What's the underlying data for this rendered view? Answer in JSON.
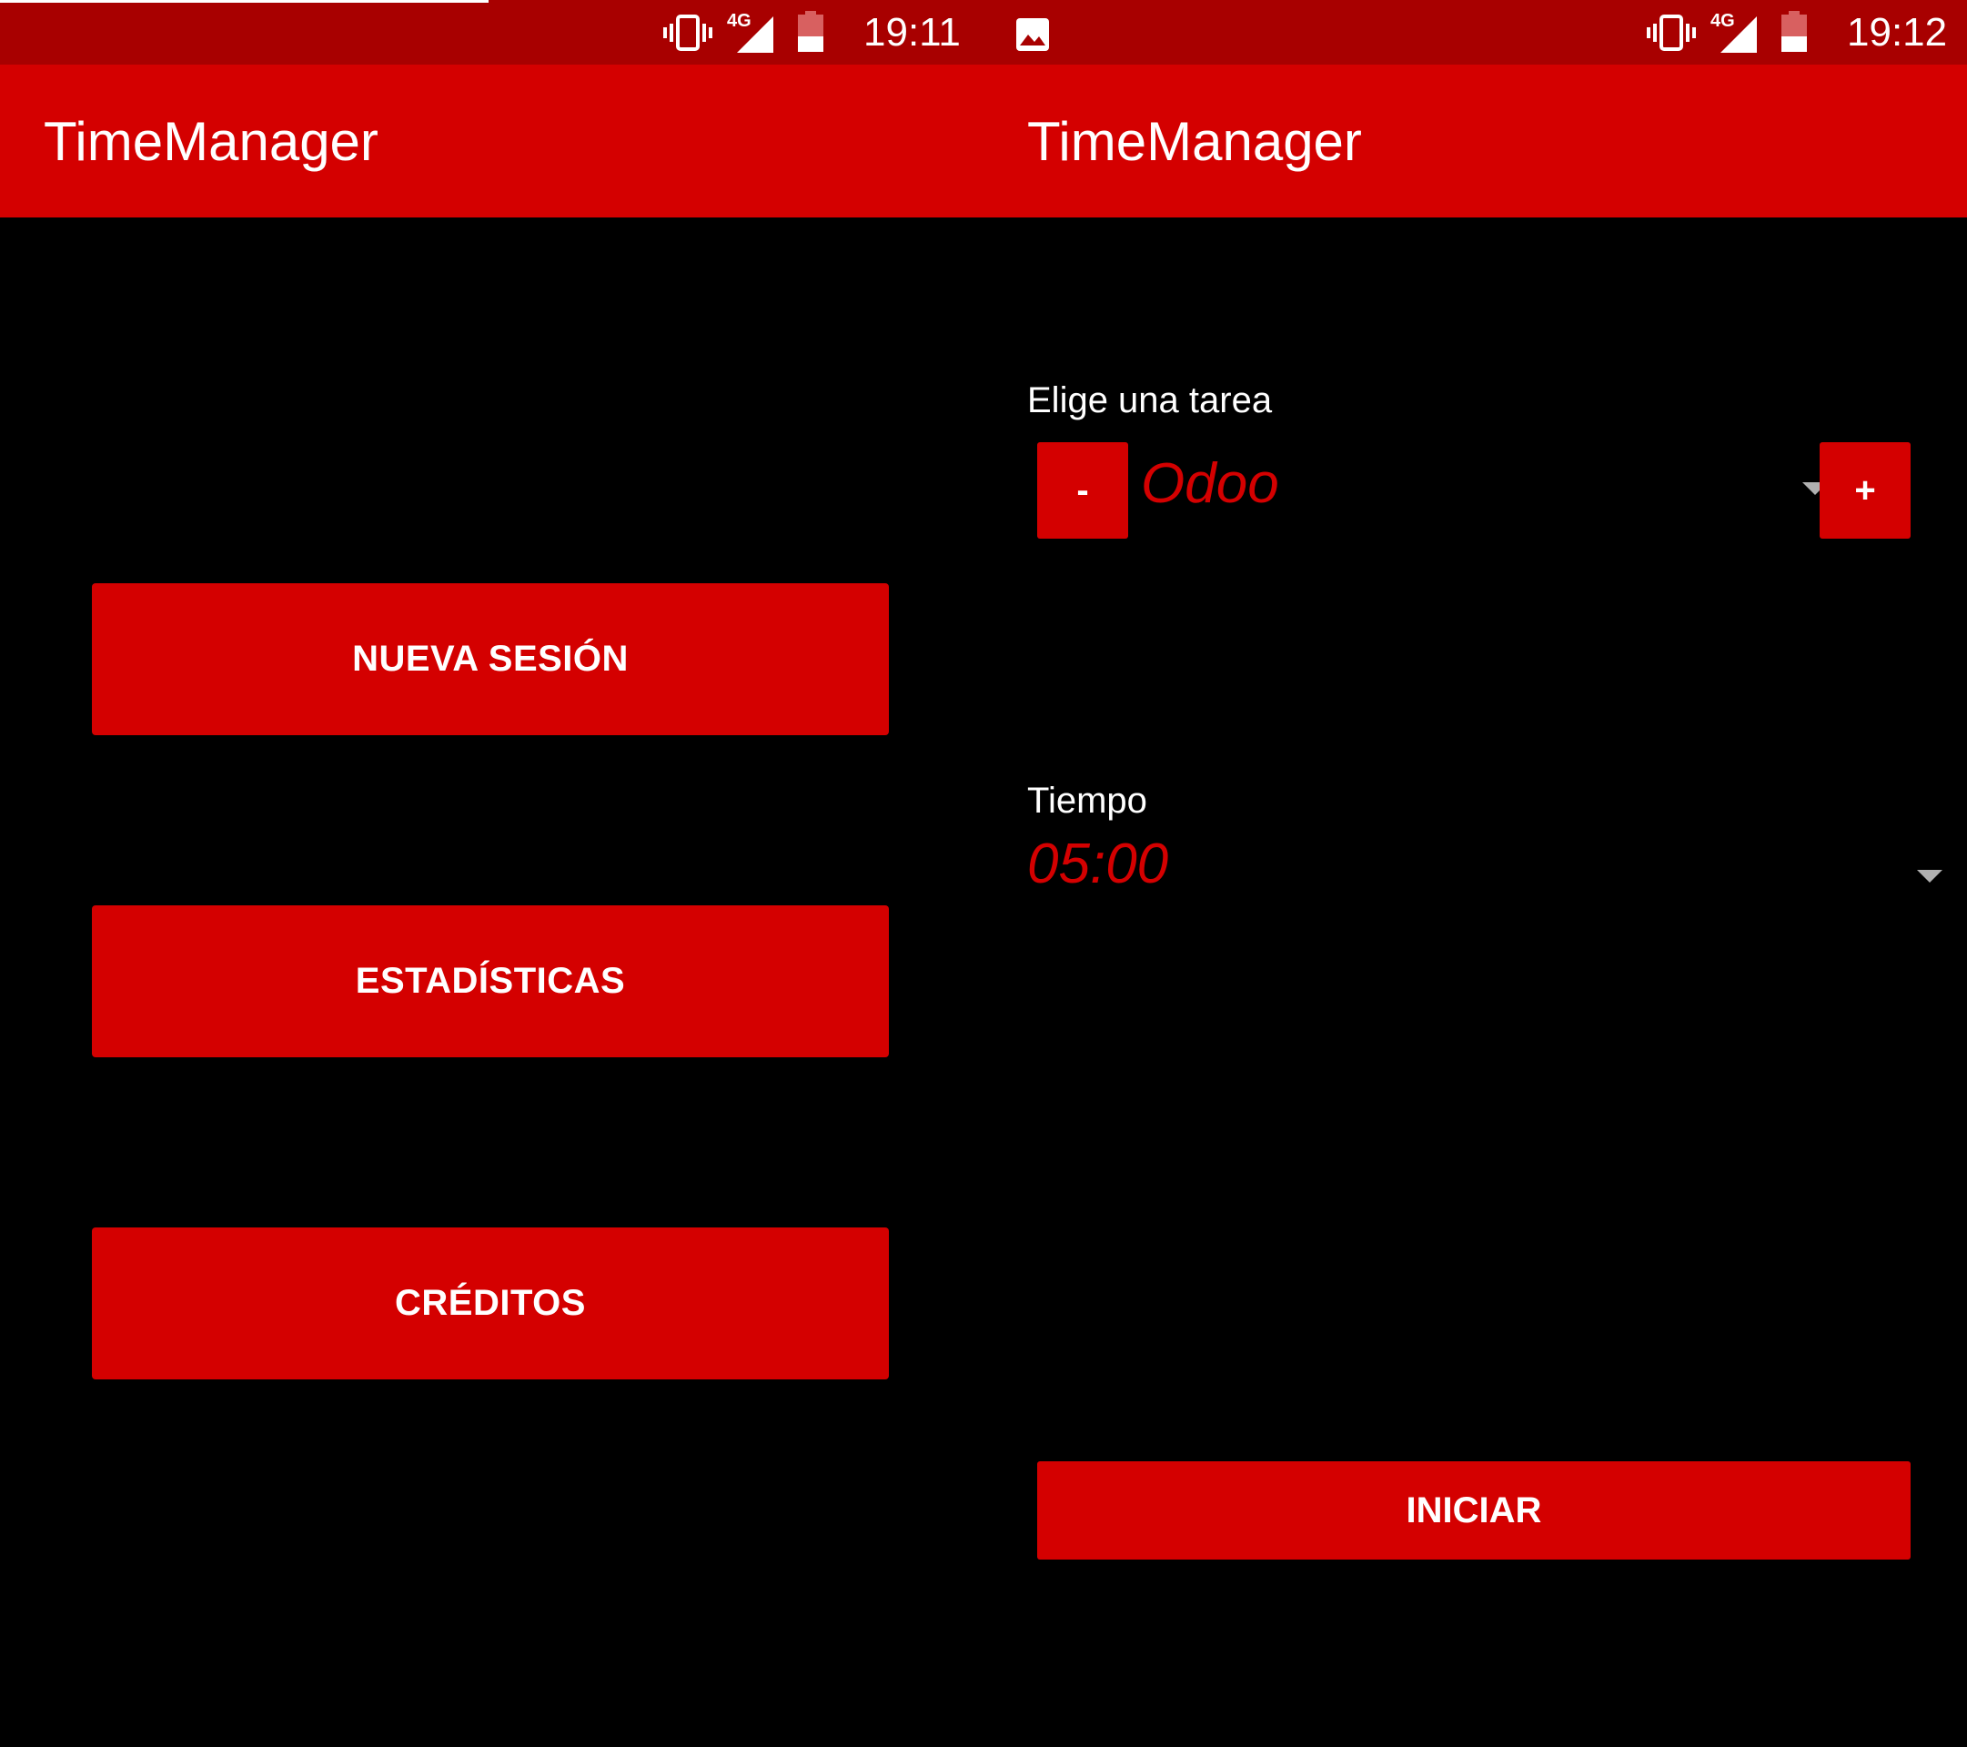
{
  "left_screen": {
    "status_bar": {
      "time": "19:11",
      "network": "4G"
    },
    "app_bar": {
      "title": "TimeManager"
    },
    "menu": {
      "new_session": "NUEVA SESIÓN",
      "statistics": "ESTADÍSTICAS",
      "credits": "CRÉDITOS"
    }
  },
  "right_screen": {
    "status_bar": {
      "time": "19:12",
      "network": "4G"
    },
    "app_bar": {
      "title": "TimeManager"
    },
    "task": {
      "label": "Elige una tarea",
      "selected": "Odoo",
      "remove_label": "-",
      "add_label": "+"
    },
    "time": {
      "label": "Tiempo",
      "selected": "05:00"
    },
    "start_label": "INICIAR"
  },
  "colors": {
    "status_bar": "#a80000",
    "app_bar": "#d40000",
    "accent": "#d40000",
    "background": "#000000",
    "text": "#ffffff",
    "caret": "#b0b0b0"
  },
  "icons": {
    "vibrate": "vibrate-icon",
    "signal": "signal-icon",
    "battery": "battery-icon",
    "image_notification": "image-icon",
    "dropdown": "chevron-down-icon"
  }
}
